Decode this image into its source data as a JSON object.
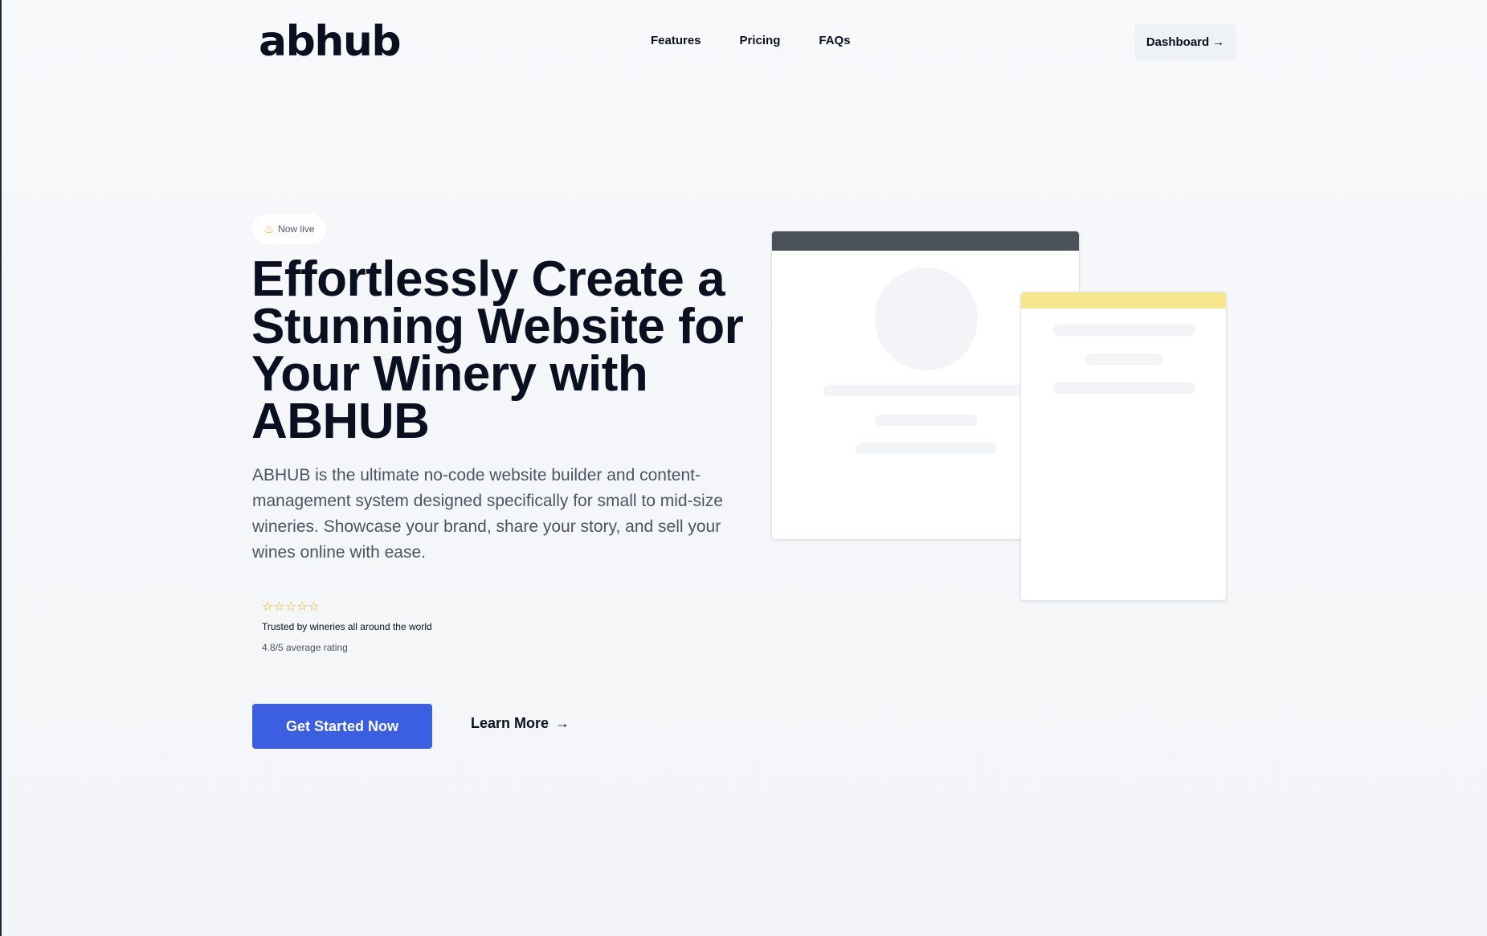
{
  "nav": {
    "logo": "abhub",
    "links": [
      "Features",
      "Pricing",
      "FAQs"
    ],
    "dashboard_label": "Dashboard",
    "dashboard_arrow": "→"
  },
  "hero": {
    "badge_icon": "fire-icon",
    "badge_label": "Now live",
    "title": "Effortlessly Create a Stunning Website for Your Winery with ABHUB",
    "description": "ABHUB is the ultimate no-code website builder and content-management system designed specifically for small to mid-size wineries. Showcase your brand, share your story, and sell your wines online with ease.",
    "trust": {
      "stars": "☆☆☆☆☆",
      "title": "Trusted by wineries all around the world",
      "subtitle": "4.8/5 average rating"
    },
    "primary_cta": "Get Started Now",
    "secondary_cta": "Learn More",
    "secondary_arrow": "→"
  },
  "colors": {
    "accent": "#3b5fe0",
    "card_header_dark": "#4b5159",
    "card_header_yellow": "#f7e68b",
    "star": "#eab308"
  }
}
